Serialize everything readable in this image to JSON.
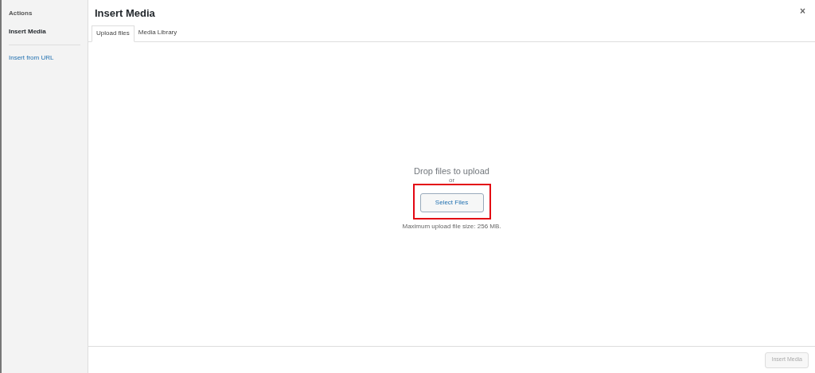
{
  "sidebar": {
    "heading": "Actions",
    "items": [
      {
        "label": "Insert Media",
        "selected": true
      },
      {
        "label": "Insert from URL",
        "selected": false
      }
    ]
  },
  "title": "Insert Media",
  "close": "×",
  "tabs": [
    {
      "label": "Upload files",
      "selected": true
    },
    {
      "label": "Media Library",
      "selected": false
    }
  ],
  "upload": {
    "heading": "Drop files to upload",
    "or": "or",
    "button": "Select Files",
    "highlighted": true,
    "note": "Maximum upload file size: 256 MB."
  },
  "footer": {
    "button": "Insert Media",
    "disabled": true
  }
}
